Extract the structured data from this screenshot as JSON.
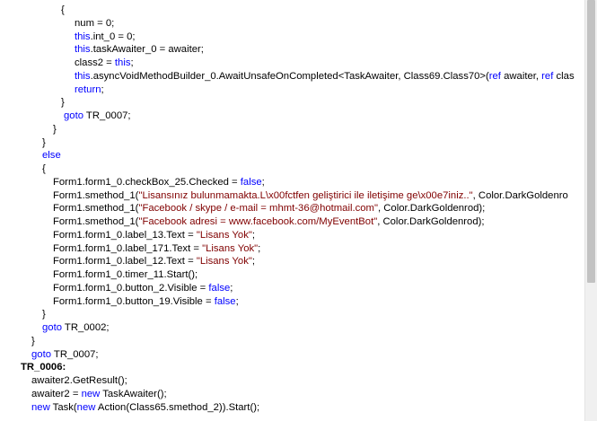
{
  "editor": {
    "lines": [
      {
        "indent": 68,
        "tokens": [
          {
            "t": "{",
            "c": "plain"
          }
        ]
      },
      {
        "indent": 83,
        "tokens": [
          {
            "t": "num = 0;",
            "c": "plain"
          }
        ]
      },
      {
        "indent": 83,
        "tokens": [
          {
            "t": "this",
            "c": "kw"
          },
          {
            "t": ".int_0 = 0;",
            "c": "plain"
          }
        ]
      },
      {
        "indent": 83,
        "tokens": [
          {
            "t": "this",
            "c": "kw"
          },
          {
            "t": ".taskAwaiter_0 = awaiter;",
            "c": "plain"
          }
        ]
      },
      {
        "indent": 83,
        "tokens": [
          {
            "t": "class2 = ",
            "c": "plain"
          },
          {
            "t": "this",
            "c": "kw"
          },
          {
            "t": ";",
            "c": "plain"
          }
        ]
      },
      {
        "indent": 83,
        "tokens": [
          {
            "t": "this",
            "c": "kw"
          },
          {
            "t": ".asyncVoidMethodBuilder_0.AwaitUnsafeOnCompleted<TaskAwaiter, Class69.Class70>(",
            "c": "plain"
          },
          {
            "t": "ref",
            "c": "kw"
          },
          {
            "t": " awaiter, ",
            "c": "plain"
          },
          {
            "t": "ref",
            "c": "kw"
          },
          {
            "t": " clas",
            "c": "plain"
          }
        ]
      },
      {
        "indent": 83,
        "tokens": [
          {
            "t": "return",
            "c": "kw"
          },
          {
            "t": ";",
            "c": "plain"
          }
        ]
      },
      {
        "indent": 68,
        "tokens": [
          {
            "t": "}",
            "c": "plain"
          }
        ]
      },
      {
        "indent": 71,
        "tokens": [
          {
            "t": "goto",
            "c": "kw"
          },
          {
            "t": " TR_0007;",
            "c": "plain"
          }
        ]
      },
      {
        "indent": 59,
        "tokens": [
          {
            "t": "}",
            "c": "plain"
          }
        ]
      },
      {
        "indent": 47,
        "tokens": [
          {
            "t": "}",
            "c": "plain"
          }
        ]
      },
      {
        "indent": 47,
        "tokens": [
          {
            "t": "else",
            "c": "kw"
          }
        ]
      },
      {
        "indent": 47,
        "tokens": [
          {
            "t": "{",
            "c": "plain"
          }
        ]
      },
      {
        "indent": 59,
        "tokens": [
          {
            "t": "Form1.form1_0.checkBox_25.Checked = ",
            "c": "plain"
          },
          {
            "t": "false",
            "c": "kw"
          },
          {
            "t": ";",
            "c": "plain"
          }
        ]
      },
      {
        "indent": 59,
        "tokens": [
          {
            "t": "Form1.smethod_1(",
            "c": "plain"
          },
          {
            "t": "\"Lisansınız bulunmamakta.L\\x00fctfen geliştirici ile iletişime ge\\x00e7iniz..\"",
            "c": "str"
          },
          {
            "t": ", Color.DarkGoldenro",
            "c": "plain"
          }
        ]
      },
      {
        "indent": 59,
        "tokens": [
          {
            "t": "Form1.smethod_1(",
            "c": "plain"
          },
          {
            "t": "\"Facebook / skype / e-mail = mhmt-36@hotmail.com\"",
            "c": "str"
          },
          {
            "t": ", Color.DarkGoldenrod);",
            "c": "plain"
          }
        ]
      },
      {
        "indent": 59,
        "tokens": [
          {
            "t": "Form1.smethod_1(",
            "c": "plain"
          },
          {
            "t": "\"Facebook adresi = www.facebook.com/MyEventBot\"",
            "c": "str"
          },
          {
            "t": ", Color.DarkGoldenrod);",
            "c": "plain"
          }
        ]
      },
      {
        "indent": 59,
        "tokens": [
          {
            "t": "Form1.form1_0.label_13.Text = ",
            "c": "plain"
          },
          {
            "t": "\"Lisans Yok\"",
            "c": "str"
          },
          {
            "t": ";",
            "c": "plain"
          }
        ]
      },
      {
        "indent": 59,
        "tokens": [
          {
            "t": "Form1.form1_0.label_171.Text = ",
            "c": "plain"
          },
          {
            "t": "\"Lisans Yok\"",
            "c": "str"
          },
          {
            "t": ";",
            "c": "plain"
          }
        ]
      },
      {
        "indent": 59,
        "tokens": [
          {
            "t": "Form1.form1_0.label_12.Text = ",
            "c": "plain"
          },
          {
            "t": "\"Lisans Yok\"",
            "c": "str"
          },
          {
            "t": ";",
            "c": "plain"
          }
        ]
      },
      {
        "indent": 59,
        "tokens": [
          {
            "t": "Form1.form1_0.timer_11.Start();",
            "c": "plain"
          }
        ]
      },
      {
        "indent": 59,
        "tokens": [
          {
            "t": "Form1.form1_0.button_2.Visible = ",
            "c": "plain"
          },
          {
            "t": "false",
            "c": "kw"
          },
          {
            "t": ";",
            "c": "plain"
          }
        ]
      },
      {
        "indent": 59,
        "tokens": [
          {
            "t": "Form1.form1_0.button_19.Visible = ",
            "c": "plain"
          },
          {
            "t": "false",
            "c": "kw"
          },
          {
            "t": ";",
            "c": "plain"
          }
        ]
      },
      {
        "indent": 47,
        "tokens": [
          {
            "t": "}",
            "c": "plain"
          }
        ]
      },
      {
        "indent": 47,
        "tokens": [
          {
            "t": "goto",
            "c": "kw"
          },
          {
            "t": " TR_0002;",
            "c": "plain"
          }
        ]
      },
      {
        "indent": 35,
        "tokens": [
          {
            "t": "}",
            "c": "plain"
          }
        ]
      },
      {
        "indent": 35,
        "tokens": [
          {
            "t": "goto",
            "c": "kw"
          },
          {
            "t": " TR_0007;",
            "c": "plain"
          }
        ]
      },
      {
        "indent": 23,
        "tokens": [
          {
            "t": "TR_0006:",
            "c": "label"
          }
        ]
      },
      {
        "indent": 35,
        "tokens": [
          {
            "t": "awaiter2.GetResult();",
            "c": "plain"
          }
        ]
      },
      {
        "indent": 35,
        "tokens": [
          {
            "t": "awaiter2 = ",
            "c": "plain"
          },
          {
            "t": "new",
            "c": "kw"
          },
          {
            "t": " TaskAwaiter();",
            "c": "plain"
          }
        ]
      },
      {
        "indent": 35,
        "tokens": [
          {
            "t": "new",
            "c": "kw"
          },
          {
            "t": " Task(",
            "c": "plain"
          },
          {
            "t": "new",
            "c": "kw"
          },
          {
            "t": " Action(Class65.smethod_2)).Start();",
            "c": "plain"
          }
        ]
      }
    ]
  },
  "colors": {
    "keyword": "#0000ff",
    "string": "#800000",
    "text": "#000000",
    "background": "#ffffff",
    "scrollbar_track": "#f0f0f0",
    "scrollbar_thumb": "#c2c2c2"
  }
}
